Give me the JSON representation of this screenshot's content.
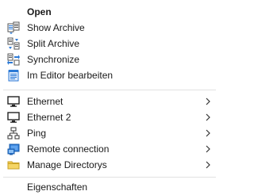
{
  "menu": {
    "items": [
      {
        "label": "Open",
        "icon": "none",
        "bold": true
      },
      {
        "label": "Show Archive",
        "icon": "archive-icon"
      },
      {
        "label": "Split Archive",
        "icon": "split-icon"
      },
      {
        "label": "Synchronize",
        "icon": "sync-icon"
      },
      {
        "label": "Im Editor bearbeiten",
        "icon": "notepad-icon"
      },
      {
        "label": "Ethernet",
        "icon": "monitor-icon",
        "submenu": true
      },
      {
        "label": "Ethernet 2",
        "icon": "monitor-icon",
        "submenu": true
      },
      {
        "label": "Ping",
        "icon": "network-icon",
        "submenu": true
      },
      {
        "label": "Remote connection",
        "icon": "remote-icon",
        "submenu": true
      },
      {
        "label": "Manage Directorys",
        "icon": "folder-icon",
        "submenu": true
      },
      {
        "label": "Eigenschaften",
        "icon": "none"
      }
    ]
  },
  "colors": {
    "background": "#ffffff",
    "text": "#1a1a1a",
    "separator": "#e2e2e2",
    "icon_blue": "#2b79d6",
    "folder_yellow": "#f2c94c"
  }
}
